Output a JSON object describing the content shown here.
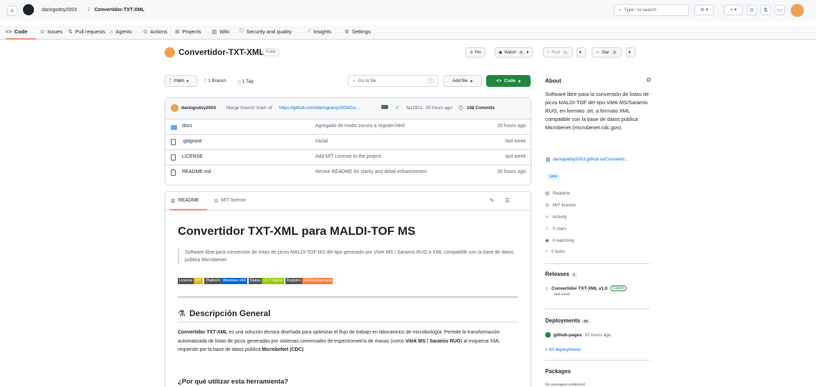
{
  "topbar": {
    "owner": "dariogodoy2003",
    "sep": "/",
    "repo": "Convertidor-TXT-XML",
    "search_placeholder": "Type / to search",
    "add_symbol": "+ ▾"
  },
  "repo_nav": [
    "Code",
    "Issues",
    "Pull requests",
    "Agents",
    "Actions",
    "Projects",
    "Wiki",
    "Security and quality",
    "Insights",
    "Settings"
  ],
  "repo_header": {
    "title": "Convertidor-TXT-XML",
    "visibility": "Public",
    "pin": "Pin",
    "watch": "Watch",
    "watch_count": "0",
    "fork": "Fork",
    "fork_count": "0",
    "star": "Star",
    "star_count": "0"
  },
  "toolbar": {
    "branch": "main",
    "branches": "1 Branch",
    "tags": "1 Tag",
    "goto": "Go to file",
    "goto_key": "t",
    "add_file": "Add file",
    "code": "Code"
  },
  "latest_commit": {
    "author": "dariogodoy2003",
    "message": "Merge branch 'main' of",
    "link": "https://github.com/dariogodoy2003/Co...",
    "hash": "fa12812",
    "time": "20 hours ago",
    "commits": "108 Commits"
  },
  "files": [
    {
      "name": "docs",
      "type": "folder",
      "commit": "Agregado de modo oscuro a register.html",
      "time": "20 hours ago"
    },
    {
      "name": ".gitignore",
      "type": "file",
      "commit": "Inicial",
      "time": "last week"
    },
    {
      "name": "LICENSE",
      "type": "file",
      "commit": "Add MIT License to the project",
      "time": "last week"
    },
    {
      "name": "README.md",
      "type": "file",
      "commit": "Revise README for clarity and detail enhancement",
      "time": "20 hours ago"
    }
  ],
  "readme": {
    "tab1": "README",
    "tab2": "MIT license",
    "h1": "Convertidor TXT-XML para MALDI-TOF MS",
    "quote": "Software libre para conversión de listas de picos MALDI-TOF MS del tipo generado por Vitek MS / Saramis RUO a XML compatible con la base de datos pública MicrobeNet.",
    "badges": [
      {
        "l": "License",
        "r": "MIT",
        "c": "#dfb317"
      },
      {
        "l": "Platform",
        "r": "Windows x64",
        "c": "#0366d6"
      },
      {
        "l": "Status",
        "r": "v1.0 Stable",
        "c": "#97ca00"
      },
      {
        "l": "Registro",
        "r": "DNDA Argentina",
        "c": "#fe7d37"
      }
    ],
    "h2_icon": "⚗",
    "h2": "Descripción General",
    "para_strong1": "Convertidor TXT-XML",
    "para_a": " es una solución técnica diseñada para optimizar el flujo de trabajo en laboratorios de microbiología. Permite la transformación automatizada de listas de picos generadas por sistemas comerciales de espectrometría de masas (como ",
    "para_strong2": "Vitek MS / Saramis RUO",
    "para_b": ") al esquema XML requerido por la base de datos pública ",
    "para_strong3": "MicrobeNet (CDC)",
    "para_c": ".",
    "h3": "¿Por qué utilizar esta herramienta?"
  },
  "about": {
    "title": "About",
    "desc": "Software libre para la conversión de listas de picos MALDI-TOF del tipo Vitek MS/Saramis RUO, en formato .txt, a formato XML compatible con la base de datos pública Microbenet (microbenet.cdc.gov).",
    "link": "dariogodoy2003.github.io/Convertid...",
    "topic": "java",
    "readme": "Readme",
    "license": "MIT license",
    "activity": "Activity",
    "stars": "0 stars",
    "watching": "0 watching",
    "forks": "0 forks"
  },
  "releases": {
    "title": "Releases",
    "count": "1",
    "name": "Convertidor TXT-XML v1.0",
    "latest": "Latest",
    "when": "last week"
  },
  "deployments": {
    "title": "Deployments",
    "count": "84",
    "env": "github-pages",
    "when": "20 hours ago",
    "more": "+ 83 deployments"
  },
  "packages": {
    "title": "Packages",
    "note": "No packages published"
  },
  "colors": {
    "green": "#1f883d",
    "link": "#0969da",
    "accent": "#fd8c73",
    "folder": "#54aeff"
  }
}
